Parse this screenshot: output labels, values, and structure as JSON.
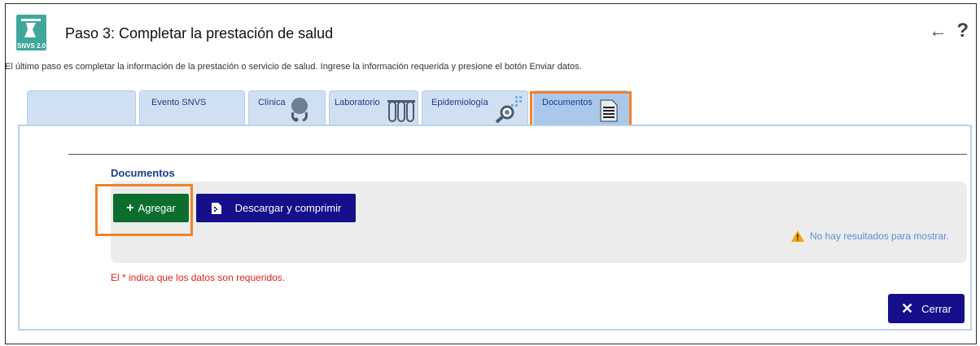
{
  "header": {
    "logo_text": "SNVS 2.0",
    "title": "Paso 3: Completar la prestación de salud",
    "back_icon": "arrow-left-icon",
    "help_icon": "question-mark-icon",
    "back_glyph": "←",
    "help_glyph": "?"
  },
  "subtitle": "El último paso es completar la información de la prestación o servicio de salud. Ingrese la información requerida y presione el botón Enviar datos.",
  "tabs": [
    {
      "label": ""
    },
    {
      "label": "Evento SNVS"
    },
    {
      "label": "Clínica",
      "icon": "stethoscope-icon"
    },
    {
      "label": "Laboratorio",
      "icon": "test-tubes-icon"
    },
    {
      "label": "Epidemiología",
      "icon": "magnifier-icon"
    },
    {
      "label": "Documentos",
      "icon": "document-icon",
      "active": true
    }
  ],
  "documents": {
    "section_title": "Documentos",
    "add_button": "Agregar",
    "add_plus": "+",
    "download_button": "Descargar y comprimir",
    "no_results": "No hay resultados para mostrar."
  },
  "required_note": "El * indica que los datos son requeridos.",
  "close_button": "Cerrar",
  "close_glyph": "✕",
  "colors": {
    "primary_button": "#150f8c",
    "add_button": "#0c6d2f",
    "highlight": "#f08227",
    "tab_bg": "#cfe0f2",
    "panel_border": "#b9d3ee",
    "error_text": "#e2231a",
    "info_text": "#5b8dd6"
  }
}
